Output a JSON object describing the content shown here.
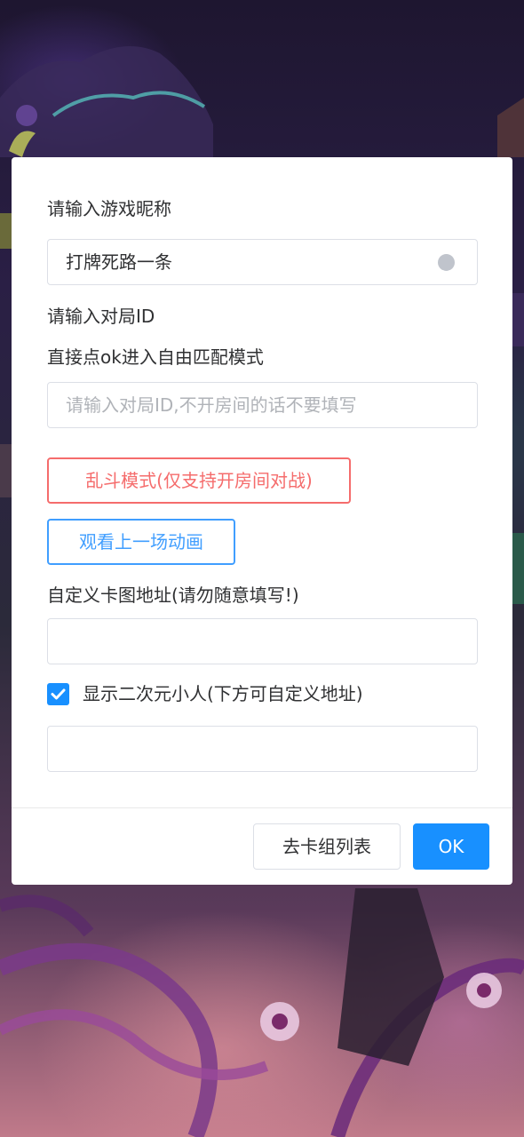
{
  "form": {
    "nickname_label": "请输入游戏昵称",
    "nickname_value": "打牌死路一条",
    "match_id_label": "请输入对局ID",
    "match_id_hint": "直接点ok进入自由匹配模式",
    "match_id_placeholder": "请输入对局ID,不开房间的话不要填写",
    "brawl_button": "乱斗模式(仅支持开房间对战)",
    "replay_button": "观看上一场动画",
    "card_image_label": "自定义卡图地址(请勿随意填写!)",
    "card_image_value": "",
    "show_character_label": "显示二次元小人(下方可自定义地址)",
    "show_character_checked": true,
    "character_url_value": ""
  },
  "footer": {
    "deck_list_button": "去卡组列表",
    "ok_button": "OK"
  },
  "colors": {
    "primary": "#1890ff",
    "danger": "#f56c6c",
    "link": "#409eff"
  }
}
